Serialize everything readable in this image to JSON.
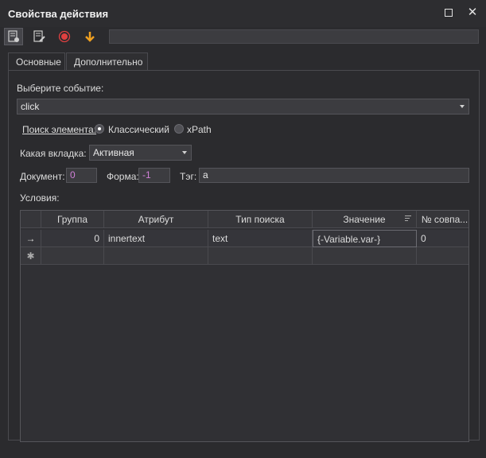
{
  "window": {
    "title": "Свойства действия"
  },
  "tabs": [
    {
      "label": "Основные"
    },
    {
      "label": "Дополнительно"
    }
  ],
  "form": {
    "event_label": "Выберите событие:",
    "event_value": "click",
    "search_label": "Поиск элемента:",
    "search_options": [
      {
        "label": "Классический",
        "selected": true
      },
      {
        "label": "xPath",
        "selected": false
      }
    ],
    "tab_label": "Какая вкладка:",
    "tab_value": "Активная",
    "document_label": "Документ:",
    "document_value": "0",
    "form_label": "Форма:",
    "form_value": "-1",
    "tag_label": "Тэг:",
    "tag_value": "a",
    "conditions_label": "Условия:"
  },
  "grid": {
    "columns": [
      "Группа",
      "Атрибут",
      "Тип поиска",
      "Значение",
      "№ совпа..."
    ],
    "rows": [
      {
        "marker": "→",
        "group": "0",
        "attribute": "innertext",
        "search_type": "text",
        "value": "{-Variable.var-}",
        "match_no": "0"
      }
    ],
    "new_row_marker": "✱"
  },
  "colors": {
    "background": "#2b2b2e",
    "record_red": "#e04040",
    "arrow_orange": "#f0a020",
    "accent_magenta": "#d080d8"
  }
}
